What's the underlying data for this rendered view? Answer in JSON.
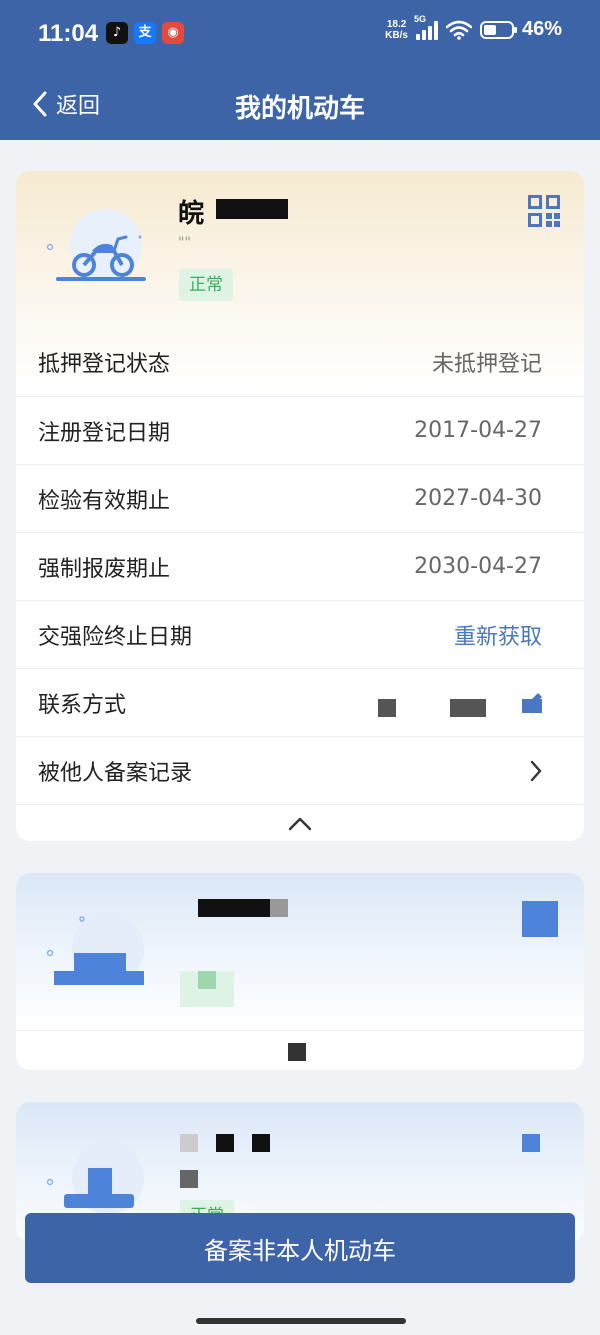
{
  "status_bar": {
    "time": "11:04",
    "app_icons": [
      "tiktok-icon",
      "alipay-icon",
      "game-app-icon"
    ],
    "net_speed_value": "18.2",
    "net_speed_unit": "KB/s",
    "network_type": "5G",
    "battery_percent": "46%",
    "battery_level": 0.46
  },
  "header": {
    "back_label": "返回",
    "title": "我的机动车"
  },
  "vehicle_card": {
    "plate_visible": "皖",
    "plate_partial": "0 0",
    "sub_partial": "\"\"",
    "status_badge": "正常",
    "rows": [
      {
        "label": "抵押登记状态",
        "value": "未抵押登记"
      },
      {
        "label": "注册登记日期",
        "value": "2017-04-27"
      },
      {
        "label": "检验有效期止",
        "value": "2027-04-30"
      },
      {
        "label": "强制报废期止",
        "value": "2030-04-27"
      },
      {
        "label": "交强险终止日期",
        "value": "重新获取"
      },
      {
        "label": "联系方式",
        "value": ""
      },
      {
        "label": "被他人备案记录",
        "value": ""
      }
    ]
  },
  "third_card": {
    "status_badge": "正常"
  },
  "bottom_button": {
    "label": "备案非本人机动车"
  },
  "colors": {
    "primary": "#3e64a8",
    "link": "#4a78c0",
    "badge_bg": "#def3e4",
    "badge_text": "#3caa63"
  }
}
